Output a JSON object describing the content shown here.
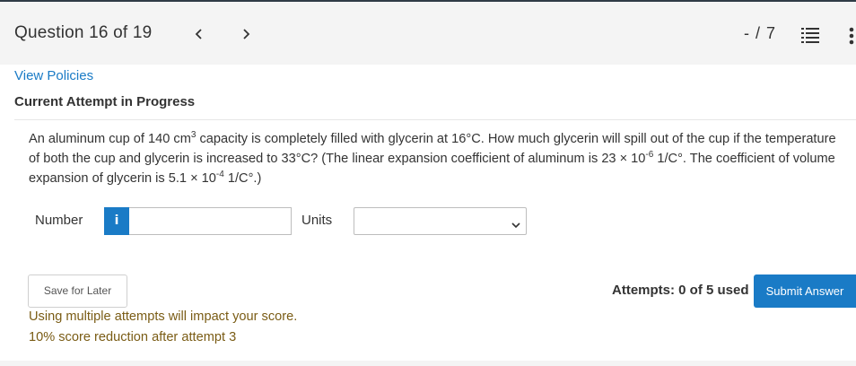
{
  "header": {
    "question_label": "Question 16 of 19",
    "score": "- / 7",
    "icons": {
      "prev": "chevron-left-icon",
      "next": "chevron-right-icon",
      "list": "list-icon",
      "more": "more-vertical-icon"
    }
  },
  "links": {
    "view_policies": "View Policies"
  },
  "attempt": {
    "title": "Current Attempt in Progress"
  },
  "question": {
    "part1": "An aluminum cup of 140 cm",
    "sup1": "3",
    "part2": " capacity is completely filled with glycerin at 16°C. How much glycerin will spill out of the cup if the temperature of both the cup and glycerin is increased to 33°C? (The linear expansion coefficient of aluminum is 23 × 10",
    "sup2": "-6",
    "part3": " 1/C°. The coefficient of volume expansion of glycerin is 5.1 × 10",
    "sup3": "-4",
    "part4": " 1/C°.)"
  },
  "answer": {
    "number_label": "Number",
    "info_label": "i",
    "number_value": "",
    "units_label": "Units",
    "units_selected": ""
  },
  "footer": {
    "save_label": "Save for Later",
    "multi_attempt_msg": "Using multiple attempts will impact your score.",
    "reduction_msg": "10% score reduction after attempt 3",
    "attempts_text": "Attempts: 0 of 5 used",
    "submit_label": "Submit Answer"
  },
  "colors": {
    "accent": "#1a7bc6",
    "warning_text": "#7a5c15",
    "header_bg": "#f4f4f4"
  }
}
